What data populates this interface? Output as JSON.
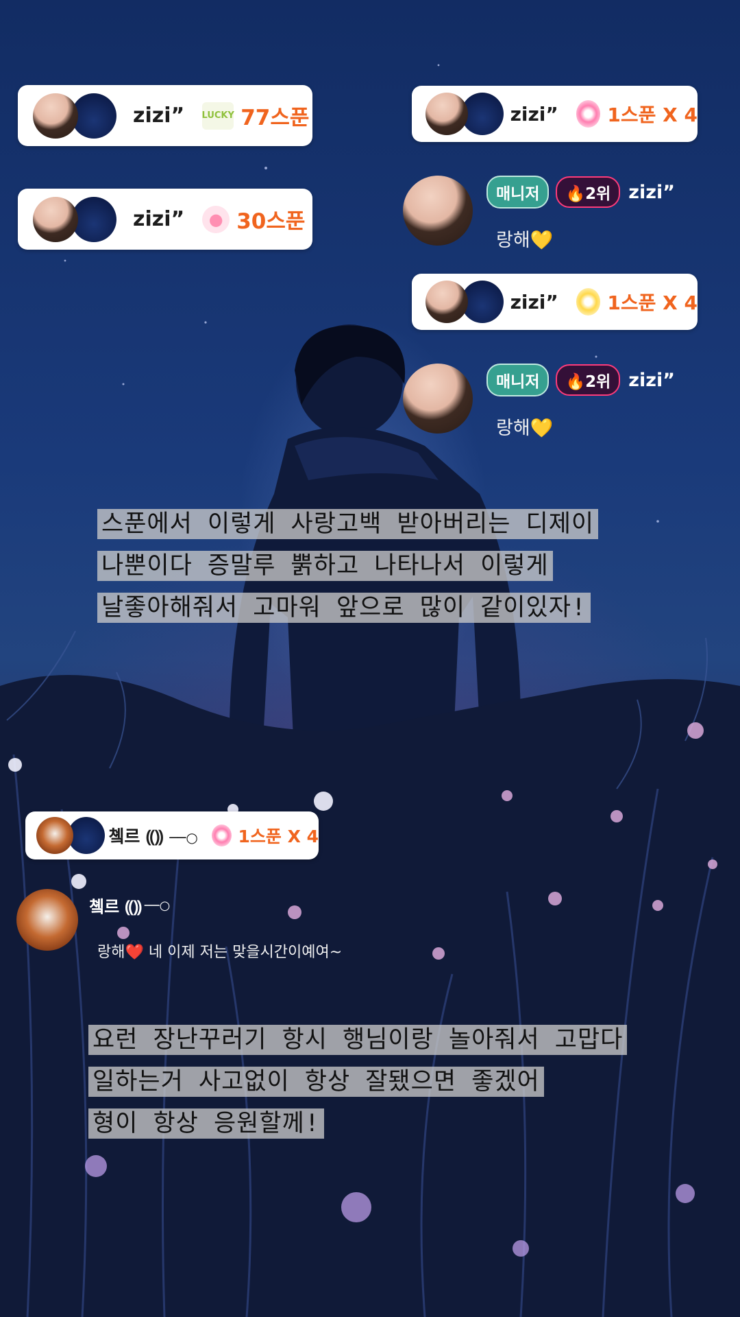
{
  "gift_cards": [
    {
      "name": "zizi”",
      "amount": "77스푼",
      "icon": "lucky-box-icon"
    },
    {
      "name": "zizi”",
      "amount": "1스푼 X 4",
      "icon": "pink-spoon-icon"
    },
    {
      "name": "zizi”",
      "amount": "30스푼",
      "icon": "pig-icon"
    },
    {
      "name": "zizi”",
      "amount": "1스푼 X 4",
      "icon": "yellow-spoon-icon"
    },
    {
      "name": "촄르 ⸨⸩",
      "amount": "1스푼 X 4",
      "icon": "pink-spoon-icon"
    }
  ],
  "chat_messages": [
    {
      "badge": "매니저",
      "rank": "2위",
      "user": "zizi”",
      "text": "랑해"
    },
    {
      "badge": "매니저",
      "rank": "2위",
      "user": "zizi”",
      "text": "랑해"
    },
    {
      "user": "촄르 ⸨⸩",
      "text_prefix": "랑해",
      "text": "네 이제 저는 맞을시간이예여~"
    }
  ],
  "handwritten": [
    {
      "lines": [
        "스푼에서 이렇게 사랑고백 받아버리는 디제이",
        "나뿐이다 증말루 뿕하고 나타나서 이렇게",
        "날좋아해줘서 고마워 앞으로 많이 같이있자!"
      ]
    },
    {
      "lines": [
        "요런 장난꾸러기 항시 행님이랑 놀아줘서 고맙다",
        "일하는거 사고없이 항상 잘됐으면 좋겠어",
        "형이 항상 응원할께!"
      ]
    }
  ],
  "colors": {
    "accent": "#f0641e",
    "manager_badge": "#36a090",
    "rank_border": "#ff3b7a"
  }
}
